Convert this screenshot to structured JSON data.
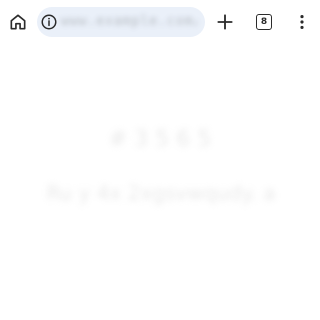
{
  "toolbar": {
    "home_icon": "home-icon",
    "site_info_icon": "info-icon",
    "new_tab_icon": "plus-icon",
    "tab_count": "8",
    "menu_icon": "more-vert-icon"
  },
  "omnibox": {
    "url": "www.example.com/page"
  },
  "page": {
    "heading": "# 3 5 6 5",
    "message": "Ru y 4x 2xgsvwqudy. a"
  },
  "colors": {
    "omnibox_background": "#eaf0f9",
    "icon": "#2b2b2b",
    "page_background": "#ffffff"
  }
}
